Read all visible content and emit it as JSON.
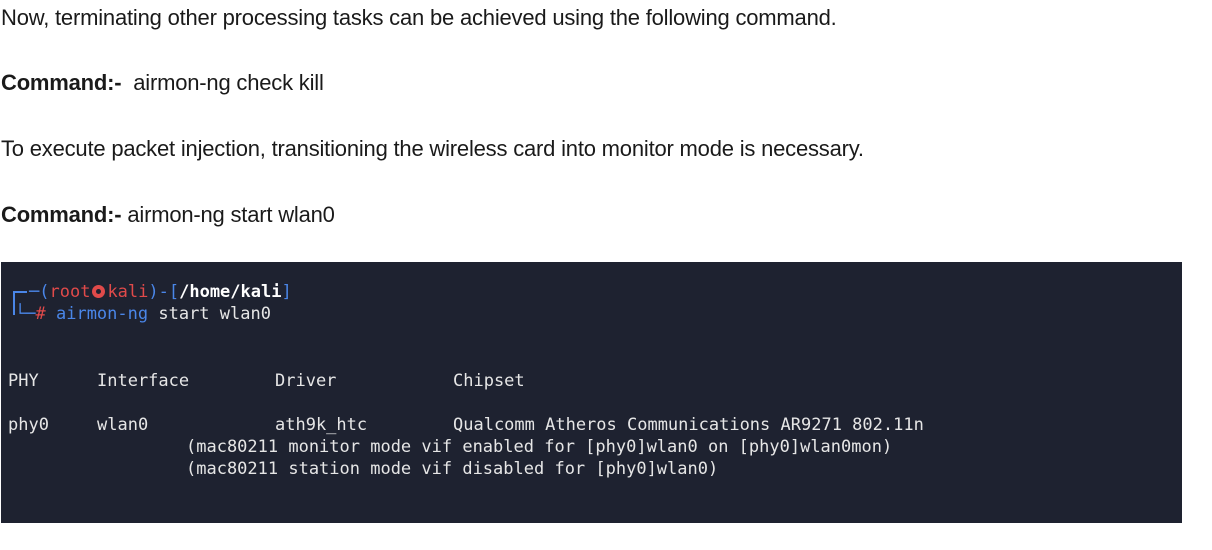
{
  "intro_text": "Now, terminating other processing tasks can be achieved using the following command.",
  "command1": {
    "label": "Command:-",
    "value": "airmon-ng check kill"
  },
  "monitor_text": "To execute packet injection, transitioning the wireless card into monitor mode is necessary.",
  "command2": {
    "label": "Command:-",
    "value": "airmon-ng start wlan0"
  },
  "terminal": {
    "prompt_user": "root",
    "prompt_host": "kali",
    "prompt_path": "/home/kali",
    "prompt_symbol": "#",
    "cmd_name": "airmon-ng",
    "cmd_args": "start wlan0",
    "headers": [
      "PHY",
      "Interface",
      "Driver",
      "Chipset"
    ],
    "row": {
      "phy": "phy0",
      "interface": "wlan0",
      "driver": "ath9k_htc",
      "chipset": "Qualcomm Atheros Communications AR9271 802.11n"
    },
    "notes": [
      "(mac80211 monitor mode vif enabled for [phy0]wlan0 on [phy0]wlan0mon)",
      "(mac80211 station mode vif disabled for [phy0]wlan0)"
    ],
    "colors": {
      "background": "#1e2230",
      "accent_blue": "#4a86e8",
      "accent_red": "#e04a4a"
    }
  }
}
